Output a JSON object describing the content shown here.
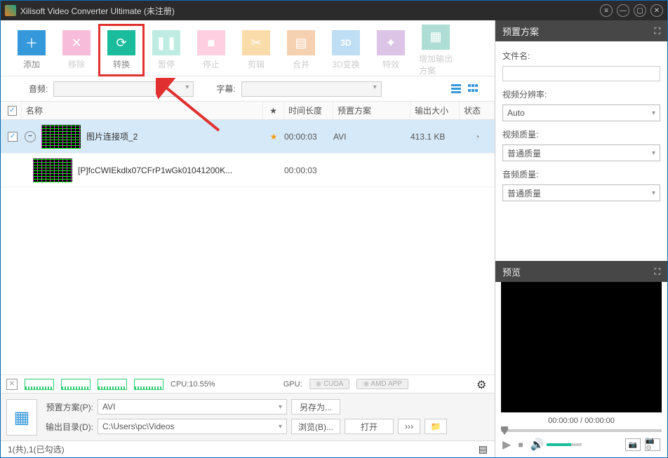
{
  "titlebar": {
    "title": "Xilisoft Video Converter Ultimate (未注册)"
  },
  "toolbar": {
    "add": "添加",
    "remove": "移除",
    "convert": "转换",
    "pause": "暂停",
    "stop": "停止",
    "clip": "剪辑",
    "merge": "合并",
    "threed": "3D变换",
    "effects": "特效",
    "addprofile": "增加输出方案"
  },
  "avrow": {
    "audio_label": "音频:",
    "subtitle_label": "字幕:"
  },
  "columns": {
    "name": "名称",
    "star": "★",
    "duration": "时间长度",
    "profile": "预置方案",
    "size": "输出大小",
    "status": "状态"
  },
  "rows": {
    "job": {
      "name": "图片连接项_2",
      "duration": "00:00:03",
      "profile": "AVI",
      "size": "413.1 KB",
      "star": "★",
      "status_icon": "◔"
    },
    "child": {
      "name": "[P]fcCWIEkdlx07CFrP1wGk01041200K...",
      "duration": "00:00:03"
    }
  },
  "stats": {
    "cpu_label": "CPU:10.55%",
    "gpu_label": "GPU:",
    "cuda": "CUDA",
    "amd": "AMD APP"
  },
  "bottom": {
    "profile_label": "预置方案(P):",
    "profile_value": "AVI",
    "saveas": "另存为...",
    "output_label": "输出目录(D):",
    "output_value": "C:\\Users\\pc\\Videos",
    "browse": "浏览(B)...",
    "open": "打开",
    "more": "›››"
  },
  "statusbar": {
    "text": "1(共),1(已勾选)"
  },
  "right": {
    "profile_header": "预置方案",
    "filename_label": "文件名:",
    "res_label": "视频分辨率:",
    "res_value": "Auto",
    "vq_label": "视频质量:",
    "vq_value": "普通质量",
    "aq_label": "音频质量:",
    "aq_value": "普通质量",
    "preview_header": "预览",
    "time": "00:00:00 / 00:00:00"
  }
}
